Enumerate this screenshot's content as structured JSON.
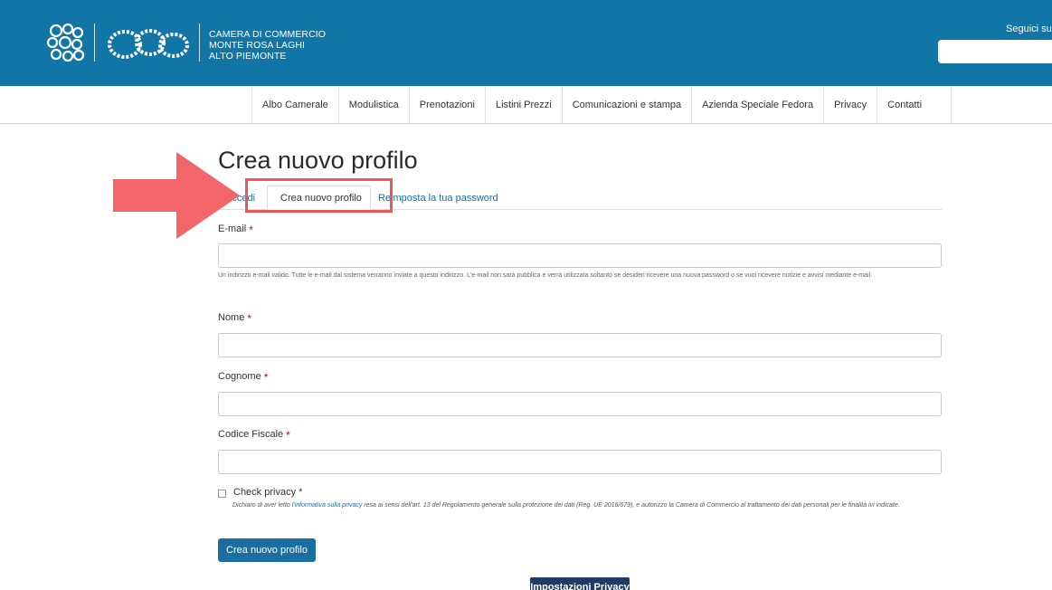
{
  "header": {
    "org_name_lines": [
      "CAMERA DI COMMERCIO",
      "MONTE ROSA LAGHI",
      "ALTO PIEMONTE"
    ],
    "follow_text": "Seguici su:",
    "background_color": "#1175a5"
  },
  "nav": {
    "items": [
      {
        "label": "Albo Camerale"
      },
      {
        "label": "Modulistica"
      },
      {
        "label": "Prenotazioni"
      },
      {
        "label": "Listini Prezzi"
      },
      {
        "label": "Comunicazioni e stampa"
      },
      {
        "label": "Azienda Speciale Fedora"
      },
      {
        "label": "Privacy"
      },
      {
        "label": "Contatti"
      }
    ]
  },
  "page": {
    "title": "Crea nuovo profilo",
    "tabs": [
      {
        "label": "Accedi"
      },
      {
        "label": "Crea nuovo profilo",
        "active": true
      },
      {
        "label": "Reimposta la tua password"
      }
    ]
  },
  "form": {
    "email": {
      "label": "E-mail",
      "required_mark": "*",
      "value": "",
      "description": "Un indirizzo e-mail valido. Tutte le e-mail dal sistema verranno inviate a questo indirizzo. L'e-mail non sarà pubblica e verrà utilizzata soltanto se desideri ricevere una nuova password o se vuoi ricevere notizie e avvisi mediante e-mail."
    },
    "nome": {
      "label": "Nome",
      "required_mark": "*",
      "value": ""
    },
    "cognome": {
      "label": "Cognome",
      "required_mark": "*",
      "value": ""
    },
    "codice_fiscale": {
      "label": "Codice Fiscale",
      "required_mark": "*",
      "value": ""
    },
    "privacy": {
      "label": "Check privacy *",
      "checked": false,
      "text_before": "Dichiaro di aver letto l'",
      "link_text": "informativa sulla privacy",
      "text_after": "  resa ai sensi dell'art. 13 del Regolamento generale sulla protezione dei dati (Reg. UE 2016/679), e autorizzo la Camera di Commercio al trattamento dei dati personali per le finalità ivi indicate."
    },
    "submit_label": "Crea nuovo profilo"
  },
  "footer": {
    "privacy_settings_label": "Impostazioni Privacy"
  },
  "annotation": {
    "color": "#e9575a"
  }
}
